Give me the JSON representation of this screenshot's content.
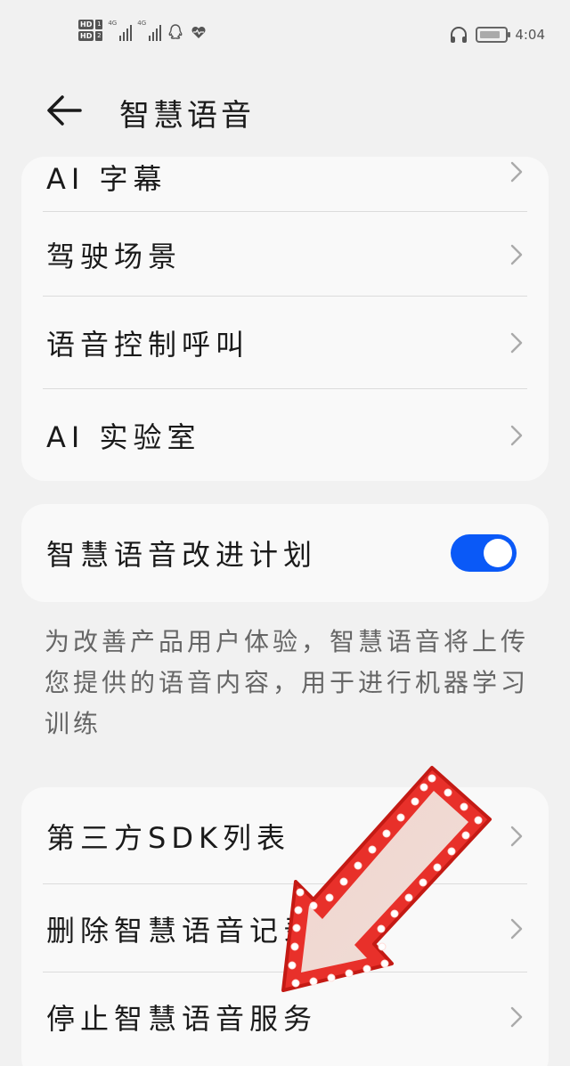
{
  "status_bar": {
    "sim1": "HD",
    "sim1_num": "1",
    "sim2": "HD",
    "sim2_num": "2",
    "net1": "4G",
    "net2": "4G",
    "time": "4:04",
    "icons": [
      "qq-icon",
      "heart-pulse-icon",
      "headphones-icon",
      "battery-icon"
    ]
  },
  "header": {
    "title": "智慧语音",
    "back_icon": "arrow-left-icon"
  },
  "group1": {
    "items": [
      {
        "label": "AI 字幕"
      },
      {
        "label": "驾驶场景"
      },
      {
        "label": "语音控制呼叫"
      },
      {
        "label": "AI 实验室"
      }
    ]
  },
  "improvement": {
    "label": "智慧语音改进计划",
    "toggle_on": true,
    "note": "为改善产品用户体验，智慧语音将上传您提供的语音内容，用于进行机器学习训练"
  },
  "group2": {
    "items": [
      {
        "label": "第三方SDK列表"
      },
      {
        "label": "删除智慧语音记录"
      },
      {
        "label": "停止智慧语音服务"
      }
    ]
  },
  "colors": {
    "accent": "#0a59f7",
    "background": "#f1f1f1",
    "card": "#f9f9f9",
    "overlay_arrow": "#e8302a"
  }
}
